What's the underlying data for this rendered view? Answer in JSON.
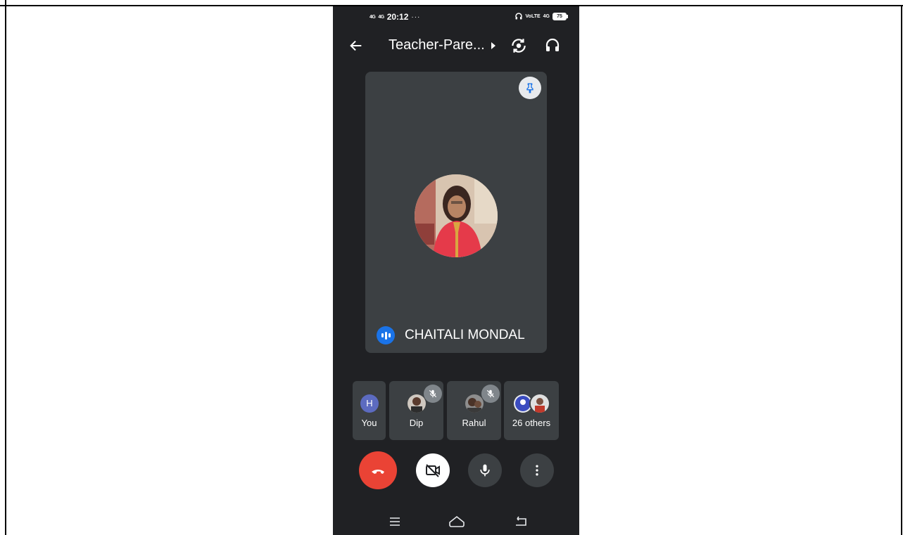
{
  "status_bar": {
    "signal_1": "4G",
    "signal_2": "4G",
    "time": "20:12",
    "dots": "···",
    "volte": "VoLTE",
    "network": "4G",
    "battery": "75"
  },
  "header": {
    "title": "Teacher-Pare...",
    "back_icon": "arrow-left-icon",
    "switch_camera_icon": "switch-camera-icon",
    "audio_icon": "headphones-icon"
  },
  "main_tile": {
    "speaker_name": "CHAITALI MONDAL",
    "pin_icon": "pin-icon",
    "speaking_icon": "speaking-indicator-icon"
  },
  "participants": [
    {
      "label": "You",
      "avatar_letter": "H",
      "muted": false
    },
    {
      "label": "Dip",
      "muted": true
    },
    {
      "label": "Rahul",
      "muted": true
    },
    {
      "label": "26 others",
      "muted": false
    }
  ],
  "controls": {
    "end_call_icon": "end-call-icon",
    "camera_icon": "camera-off-icon",
    "mic_icon": "microphone-icon",
    "more_icon": "more-vert-icon"
  },
  "colors": {
    "background": "#202124",
    "tile": "#3c4043",
    "end_call": "#ea4335",
    "speaking": "#1a73e8",
    "avatar_you": "#5c6bc0"
  }
}
